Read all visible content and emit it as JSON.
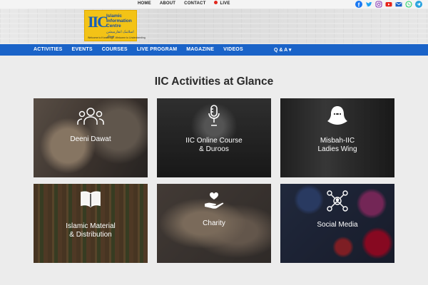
{
  "topnav": {
    "home": "HOME",
    "about": "ABOUT",
    "contact": "CONTACT",
    "live": "LIVE"
  },
  "social": [
    "facebook-icon",
    "twitter-icon",
    "instagram-icon",
    "youtube-icon",
    "email-icon",
    "whatsapp-icon",
    "telegram-icon"
  ],
  "logo": {
    "mark": "IIC",
    "line1": "Islamic",
    "line2": "Information",
    "line3": "Centre",
    "urdu": "اسلامک انفارمیشن سینٹر",
    "tagline": "Welcome to Knowledge. Welcome to Understanding"
  },
  "mainnav": {
    "items": [
      "ACTIVITIES",
      "EVENTS",
      "COURSES",
      "LIVE PROGRAM",
      "MAGAZINE",
      "VIDEOS"
    ],
    "qa": "Q & A ▾"
  },
  "section": {
    "title": "IIC Activities at Glance"
  },
  "cards": [
    {
      "label": "Deeni Dawat",
      "icon": "people-icon"
    },
    {
      "label": "IIC Online Course\n& Duroos",
      "icon": "microphone-icon"
    },
    {
      "label": "Misbah-IIC\nLadies Wing",
      "icon": "veiled-woman-icon"
    },
    {
      "label": "Islamic Material\n& Distribution",
      "icon": "book-icon"
    },
    {
      "label": "Charity",
      "icon": "heart-hand-icon"
    },
    {
      "label": "Social Media",
      "icon": "network-icon"
    }
  ],
  "colors": {
    "nav_blue": "#1a63c8",
    "logo_yellow": "#f3c316",
    "live_red": "#e1261c"
  }
}
